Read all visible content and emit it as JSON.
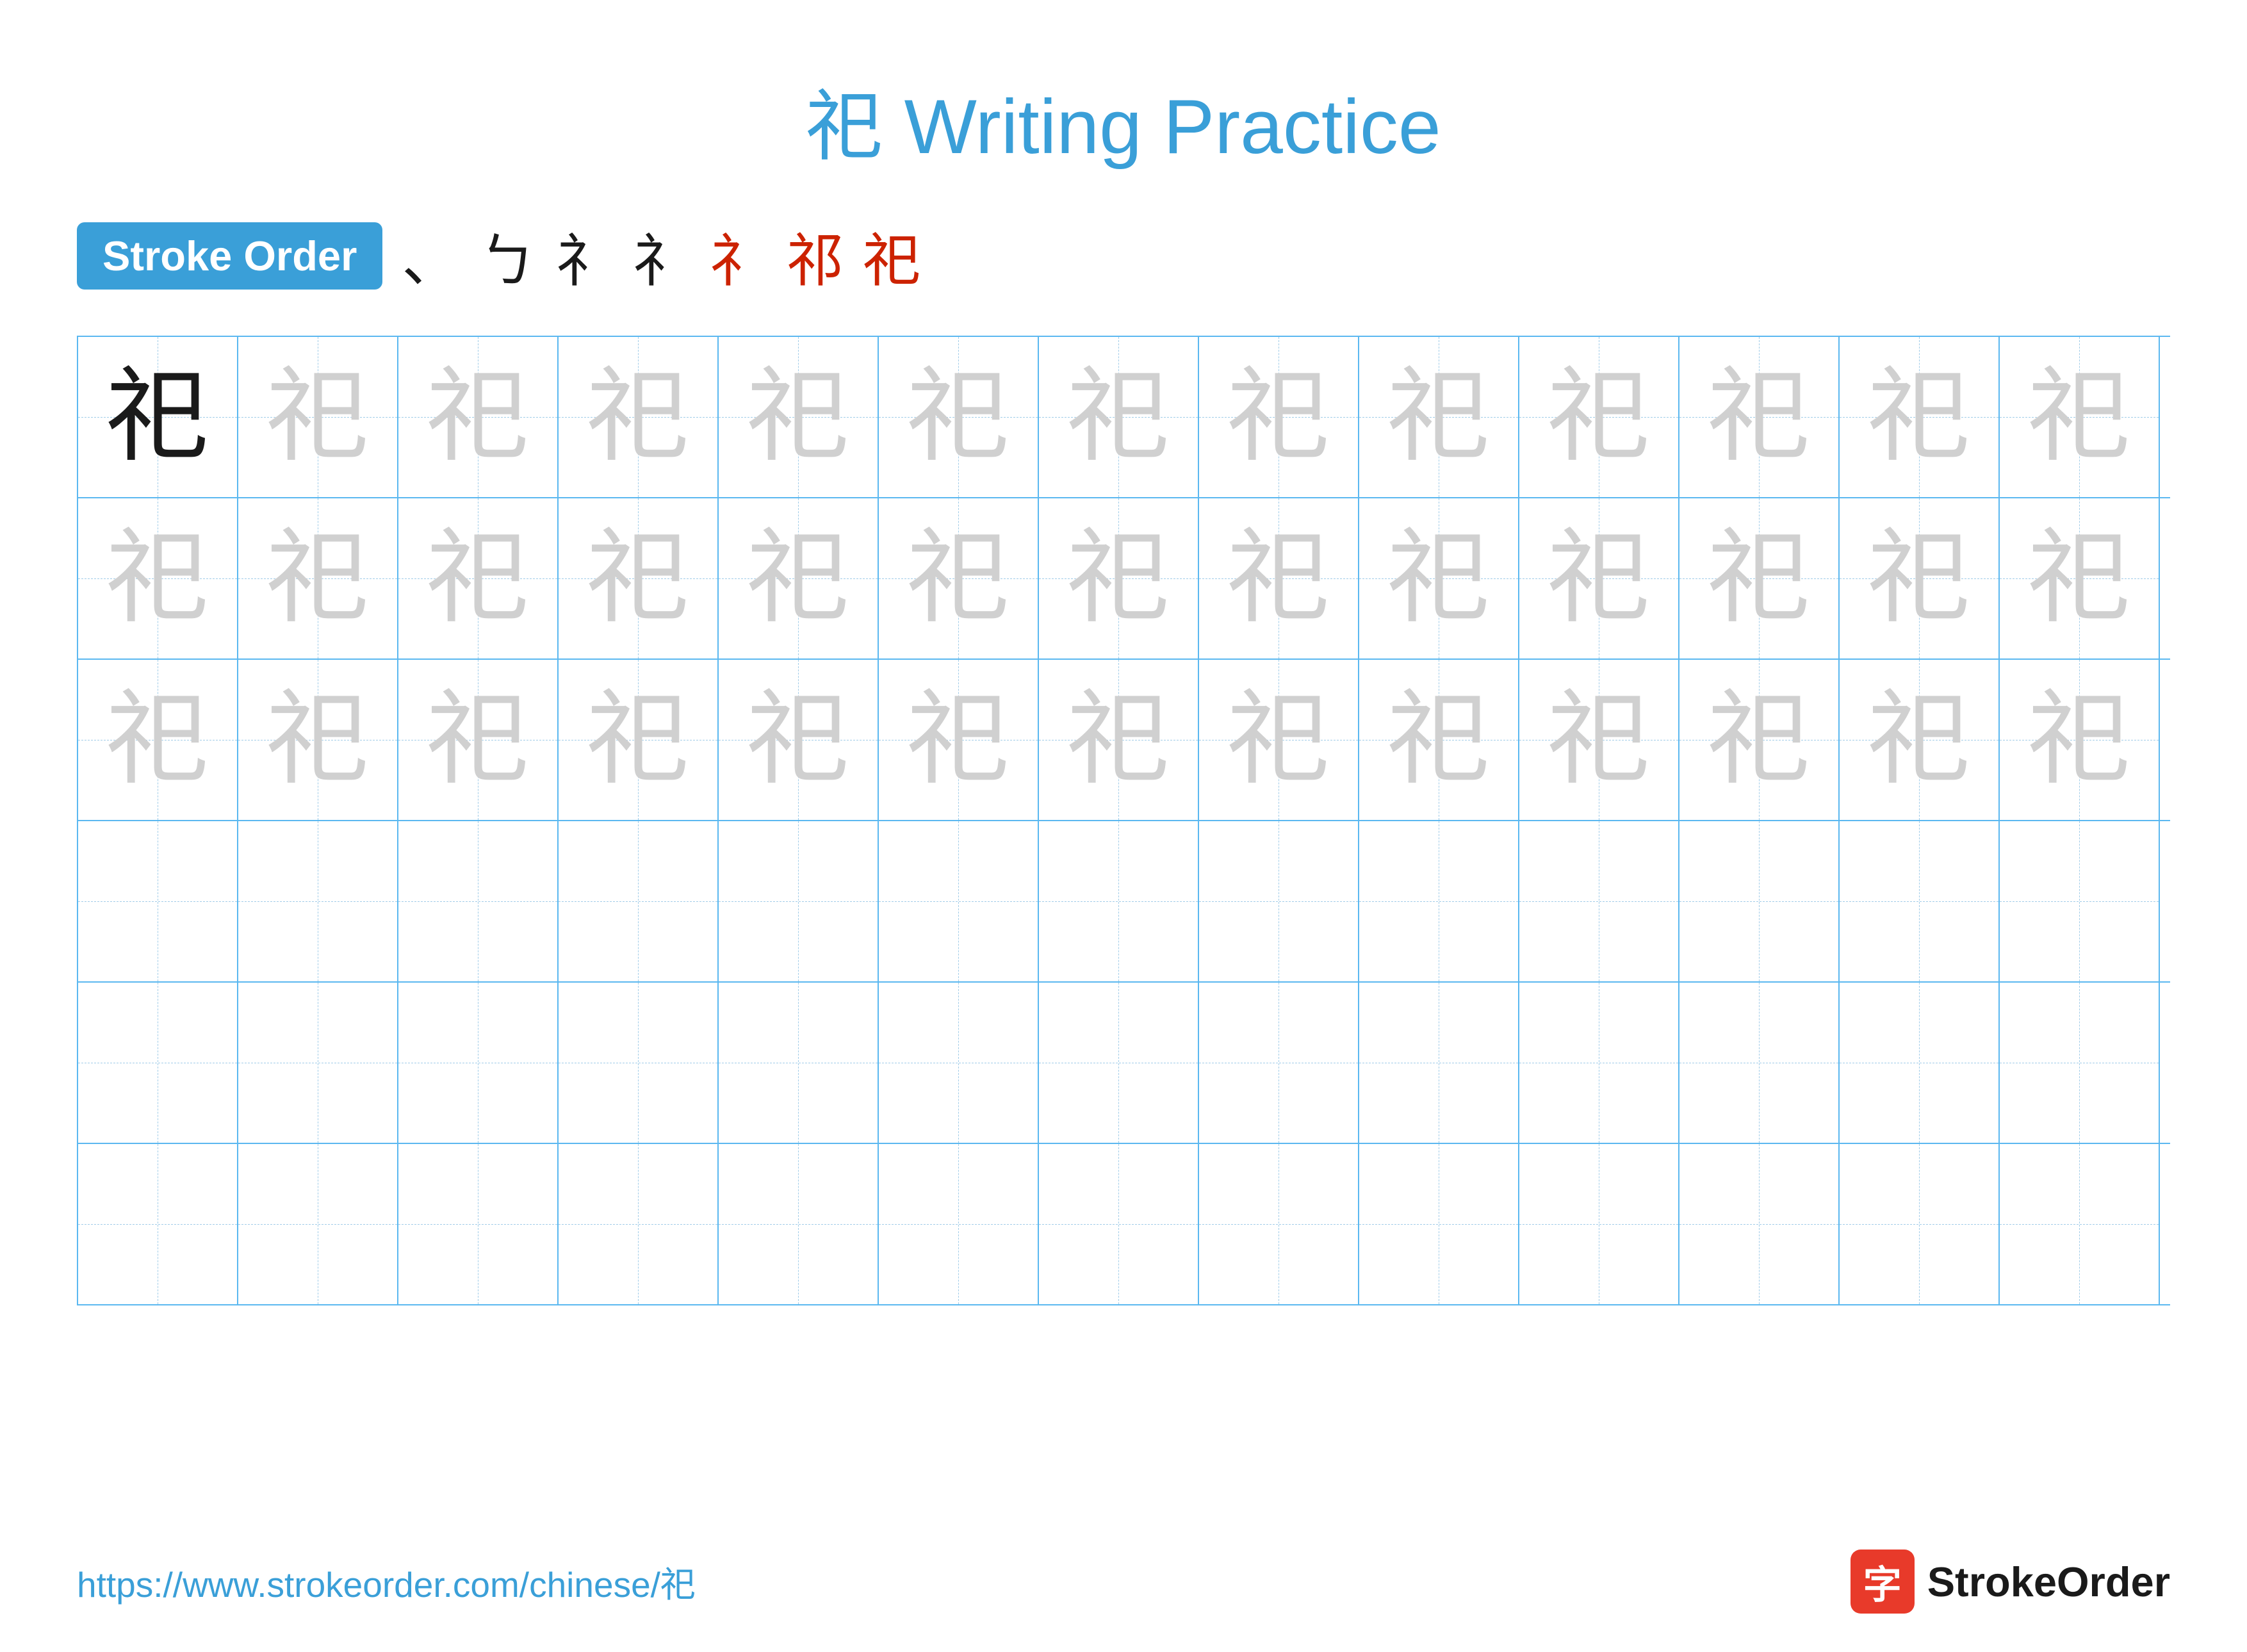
{
  "title": "祀 Writing Practice",
  "stroke_order_badge": "Stroke Order",
  "stroke_sequence": [
    "、",
    "ㄅ",
    "礻",
    "礻",
    "祁",
    "祀",
    "祀"
  ],
  "character": "祀",
  "grid": {
    "cols": 13,
    "rows": [
      {
        "type": "solid_then_light",
        "solid_count": 1
      },
      {
        "type": "all_light"
      },
      {
        "type": "all_light"
      },
      {
        "type": "empty"
      },
      {
        "type": "empty"
      },
      {
        "type": "empty"
      }
    ]
  },
  "footer": {
    "url": "https://www.strokeorder.com/chinese/祀",
    "logo_icon": "字",
    "logo_text": "StrokeOrder"
  }
}
